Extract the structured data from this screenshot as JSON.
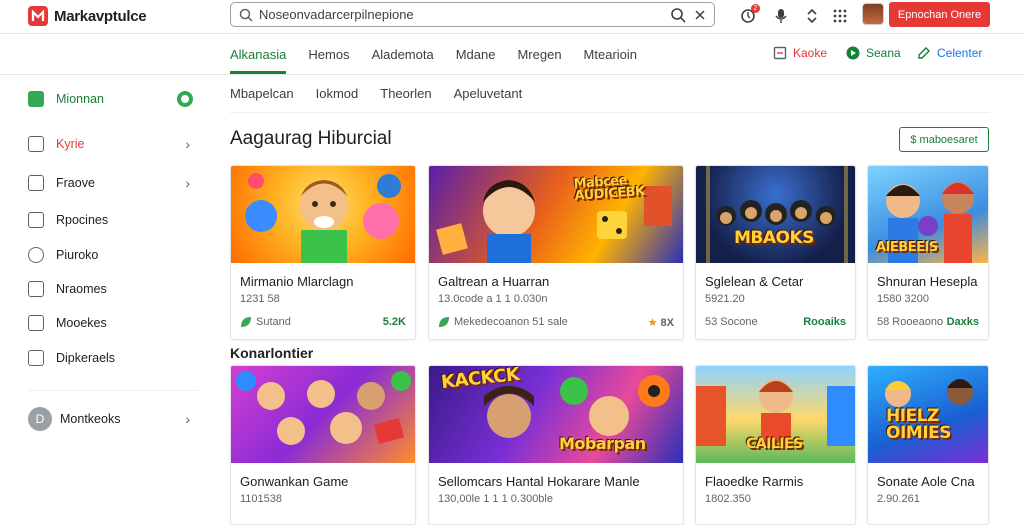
{
  "app": {
    "name": "Markavptulce"
  },
  "search": {
    "value": "Noseonvadarcerpilnepione"
  },
  "header": {
    "notif_count": "2",
    "cta_label": "Epnochan Onere"
  },
  "tabs": [
    {
      "label": "Alkanasia"
    },
    {
      "label": "Hemos"
    },
    {
      "label": "Alademota"
    },
    {
      "label": "Mdane"
    },
    {
      "label": "Mregen"
    },
    {
      "label": "Mtearioin"
    }
  ],
  "top_actions": [
    {
      "label": "Kaoke",
      "color": "#e53935"
    },
    {
      "label": "Seana",
      "color": "#188038"
    },
    {
      "label": "Celenter",
      "color": "#1a73e8"
    }
  ],
  "sidebar": {
    "items": [
      {
        "label": "Mionnan",
        "color": "#188038"
      },
      {
        "label": "Kyrie",
        "color": "#e53935"
      },
      {
        "label": "Fraove"
      },
      {
        "label": "Rpocines"
      },
      {
        "label": "Piuroko"
      },
      {
        "label": "Nraomes"
      },
      {
        "label": "Mooekes"
      },
      {
        "label": "Dipkeraels"
      },
      {
        "label": "Montkeoks"
      }
    ]
  },
  "subtabs": [
    {
      "label": "Mbapelcan"
    },
    {
      "label": "Iokmod"
    },
    {
      "label": "Theorlen"
    },
    {
      "label": "Apeluvetant"
    }
  ],
  "section1": {
    "title": "Aagaurag Hiburcial",
    "button": "$ maboesaret"
  },
  "section2": {
    "title": "Konarlontier"
  },
  "cards_row1": [
    {
      "title": "Mirmanio Mlarclagn",
      "sub": "1231 58",
      "foot": "Sutand",
      "rating": "5.2K"
    },
    {
      "title": "Galtrean a Huarran",
      "sub": "13.0code a 1 1 0.030n",
      "foot": "Mekedecoanon 51 sale",
      "rating": "8X",
      "thumb_text": "Mabcee AUDICEBK"
    },
    {
      "title": "Sglelean & Cetar",
      "sub": "5921.20",
      "foot": "53 Socone",
      "rating": "Rooaiks",
      "thumb_text": "MBAOKS"
    },
    {
      "title": "Shnuran Hesepla",
      "sub": "1580 3200",
      "foot": "58 Rooeaono",
      "rating": "Daxks",
      "thumb_text": "AIEBEEIS"
    }
  ],
  "cards_row2": [
    {
      "title": "Gonwankan Game",
      "sub": "1101538",
      "thumb_text": ""
    },
    {
      "title": "Sellomcars Hantal Hokarare Manle",
      "sub": "130,00le 1 1 1 0.300ble",
      "thumb_text": "Mobarpan"
    },
    {
      "title": "Flaoedke Rarmis",
      "sub": "1802.350",
      "thumb_text": "CAILIES"
    },
    {
      "title": "Sonate Aole Cna",
      "sub": "2.90.261",
      "thumb_text": "HIELZ OIMIES"
    }
  ]
}
